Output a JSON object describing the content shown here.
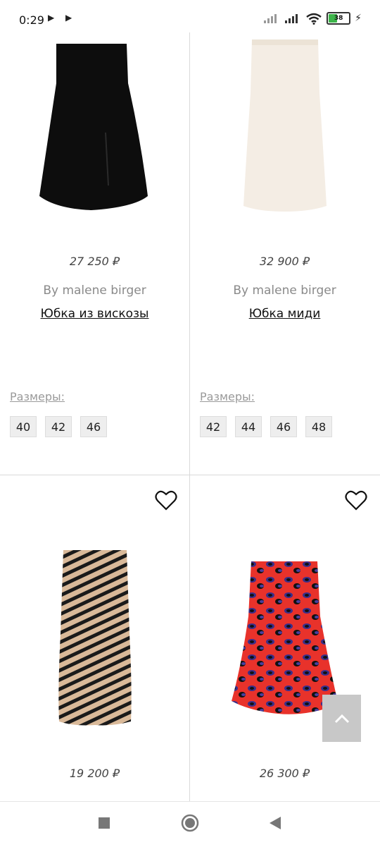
{
  "status_bar": {
    "time": "0:29",
    "battery": "38"
  },
  "products": [
    {
      "price": "27 250 ₽",
      "brand": "By malene birger",
      "title": "Юбка из вискозы",
      "sizes_label": "Размеры:",
      "sizes": [
        "40",
        "42",
        "46"
      ]
    },
    {
      "price": "32 900 ₽",
      "brand": "By malene birger",
      "title": "Юбка миди",
      "sizes_label": "Размеры:",
      "sizes": [
        "42",
        "44",
        "46",
        "48"
      ]
    },
    {
      "price": "19 200 ₽"
    },
    {
      "price": "26 300 ₽"
    }
  ],
  "icons": {
    "favorite": "heart-icon",
    "scroll_top": "chevron-up-icon",
    "nav_recents": "square-icon",
    "nav_home": "circle-icon",
    "nav_back": "triangle-back-icon"
  },
  "colors": {
    "skirt_black": "#0d0d0d",
    "skirt_cream": "#f4ede4",
    "chip_bg": "#eeeeee",
    "scroll_top_bg": "#c8c8c8"
  }
}
